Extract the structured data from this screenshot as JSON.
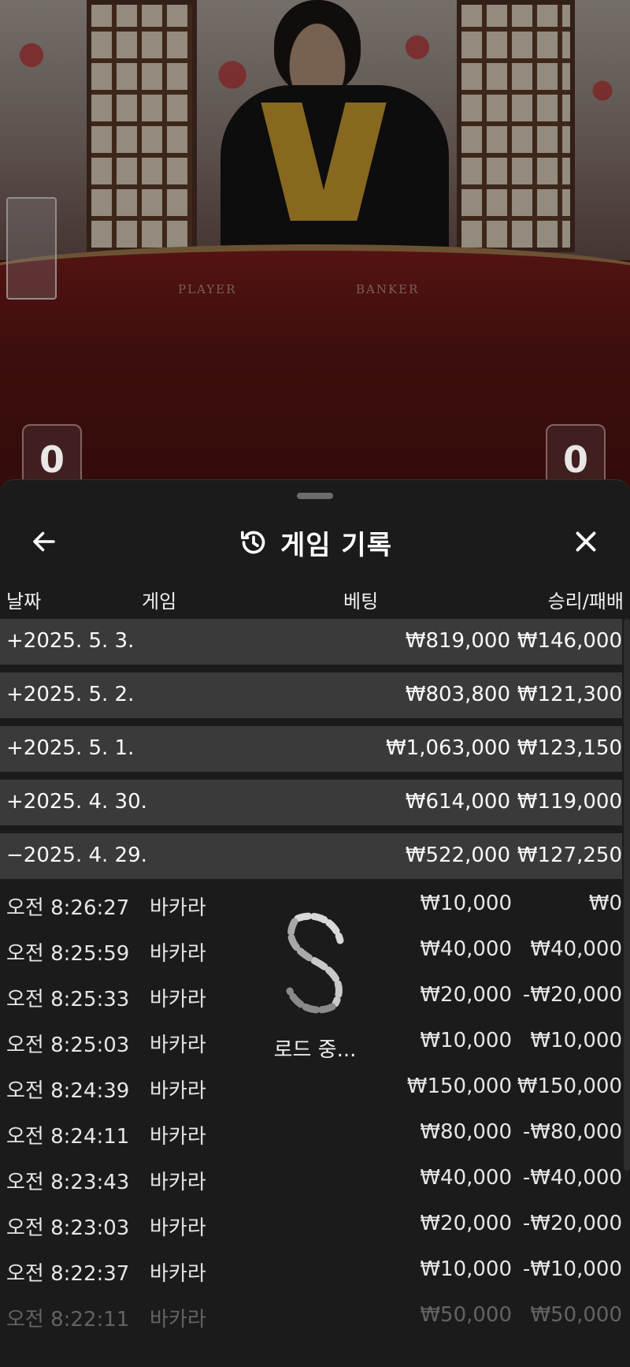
{
  "stream": {
    "table_labels": {
      "player": "PLAYER",
      "banker": "BANKER"
    },
    "scores": {
      "player": "0",
      "banker": "0"
    }
  },
  "sheet": {
    "title": "게임 기록",
    "icons": {
      "back": "arrow-left-icon",
      "history": "history-icon",
      "close": "close-icon",
      "loader": "spinner-icon"
    },
    "columns": {
      "date": "날짜",
      "game": "게임",
      "bet": "베팅",
      "win_loss": "승리/패배"
    },
    "days": [
      {
        "date": "+2025. 5. 3.",
        "bet": "₩819,000",
        "win_loss": "₩146,000"
      },
      {
        "date": "+2025. 5. 2.",
        "bet": "₩803,800",
        "win_loss": "₩121,300"
      },
      {
        "date": "+2025. 5. 1.",
        "bet": "₩1,063,000",
        "win_loss": "₩123,150"
      },
      {
        "date": "+2025. 4. 30.",
        "bet": "₩614,000",
        "win_loss": "₩119,000"
      },
      {
        "date": "−2025. 4. 29.",
        "bet": "₩522,000",
        "win_loss": "₩127,250"
      }
    ],
    "transactions": [
      {
        "time": "오전 8:26:27",
        "game": "바카라",
        "bet": "₩10,000",
        "win_loss": "₩0"
      },
      {
        "time": "오전 8:25:59",
        "game": "바카라",
        "bet": "₩40,000",
        "win_loss": "₩40,000"
      },
      {
        "time": "오전 8:25:33",
        "game": "바카라",
        "bet": "₩20,000",
        "win_loss": "-₩20,000"
      },
      {
        "time": "오전 8:25:03",
        "game": "바카라",
        "bet": "₩10,000",
        "win_loss": "₩10,000"
      },
      {
        "time": "오전 8:24:39",
        "game": "바카라",
        "bet": "₩150,000",
        "win_loss": "₩150,000"
      },
      {
        "time": "오전 8:24:11",
        "game": "바카라",
        "bet": "₩80,000",
        "win_loss": "-₩80,000"
      },
      {
        "time": "오전 8:23:43",
        "game": "바카라",
        "bet": "₩40,000",
        "win_loss": "-₩40,000"
      },
      {
        "time": "오전 8:23:03",
        "game": "바카라",
        "bet": "₩20,000",
        "win_loss": "-₩20,000"
      },
      {
        "time": "오전 8:22:37",
        "game": "바카라",
        "bet": "₩10,000",
        "win_loss": "-₩10,000"
      },
      {
        "time": "오전 8:22:11",
        "game": "바카라",
        "bet": "₩50,000",
        "win_loss": "₩50,000"
      }
    ],
    "loading_label": "로드 중..."
  },
  "colors": {
    "sheet_bg": "#1b1b1b",
    "day_row_bg": "#3a3a3a",
    "table_felt": "#5a1614",
    "lapel_gold": "#c69a2e"
  }
}
